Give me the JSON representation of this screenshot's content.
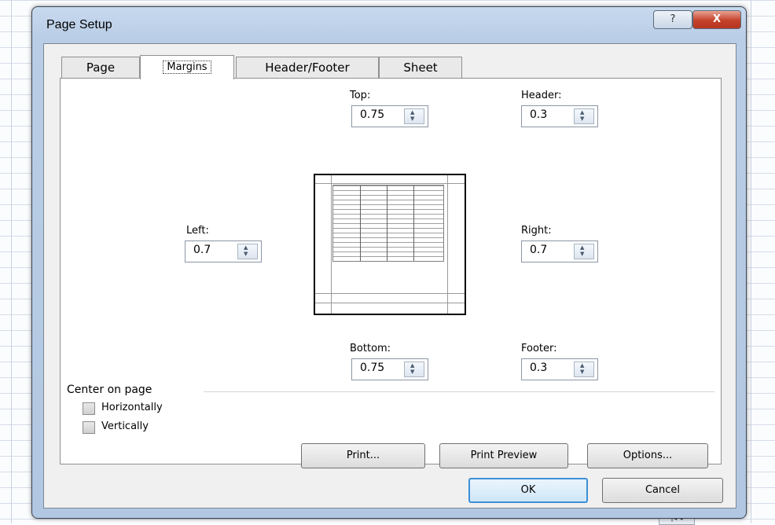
{
  "window": {
    "title": "Page Setup",
    "help_glyph": "?",
    "close_glyph": "X"
  },
  "tabs": [
    {
      "label": "Page"
    },
    {
      "label": "Margins"
    },
    {
      "label": "Header/Footer"
    },
    {
      "label": "Sheet"
    }
  ],
  "margins": {
    "top": {
      "label": "Top:",
      "value": "0.75"
    },
    "header": {
      "label": "Header:",
      "value": "0.3"
    },
    "left": {
      "label": "Left:",
      "value": "0.7"
    },
    "right": {
      "label": "Right:",
      "value": "0.7"
    },
    "bottom": {
      "label": "Bottom:",
      "value": "0.75"
    },
    "footer": {
      "label": "Footer:",
      "value": "0.3"
    }
  },
  "center_on_page": {
    "label": "Center on page",
    "horizontally": "Horizontally",
    "vertically": "Vertically"
  },
  "buttons": {
    "print": "Print...",
    "print_preview": "Print Preview",
    "options": "Options...",
    "ok": "OK",
    "cancel": "Cancel"
  },
  "colors": {
    "accent": "#3c8fd6",
    "close_red": "#c4412a"
  }
}
